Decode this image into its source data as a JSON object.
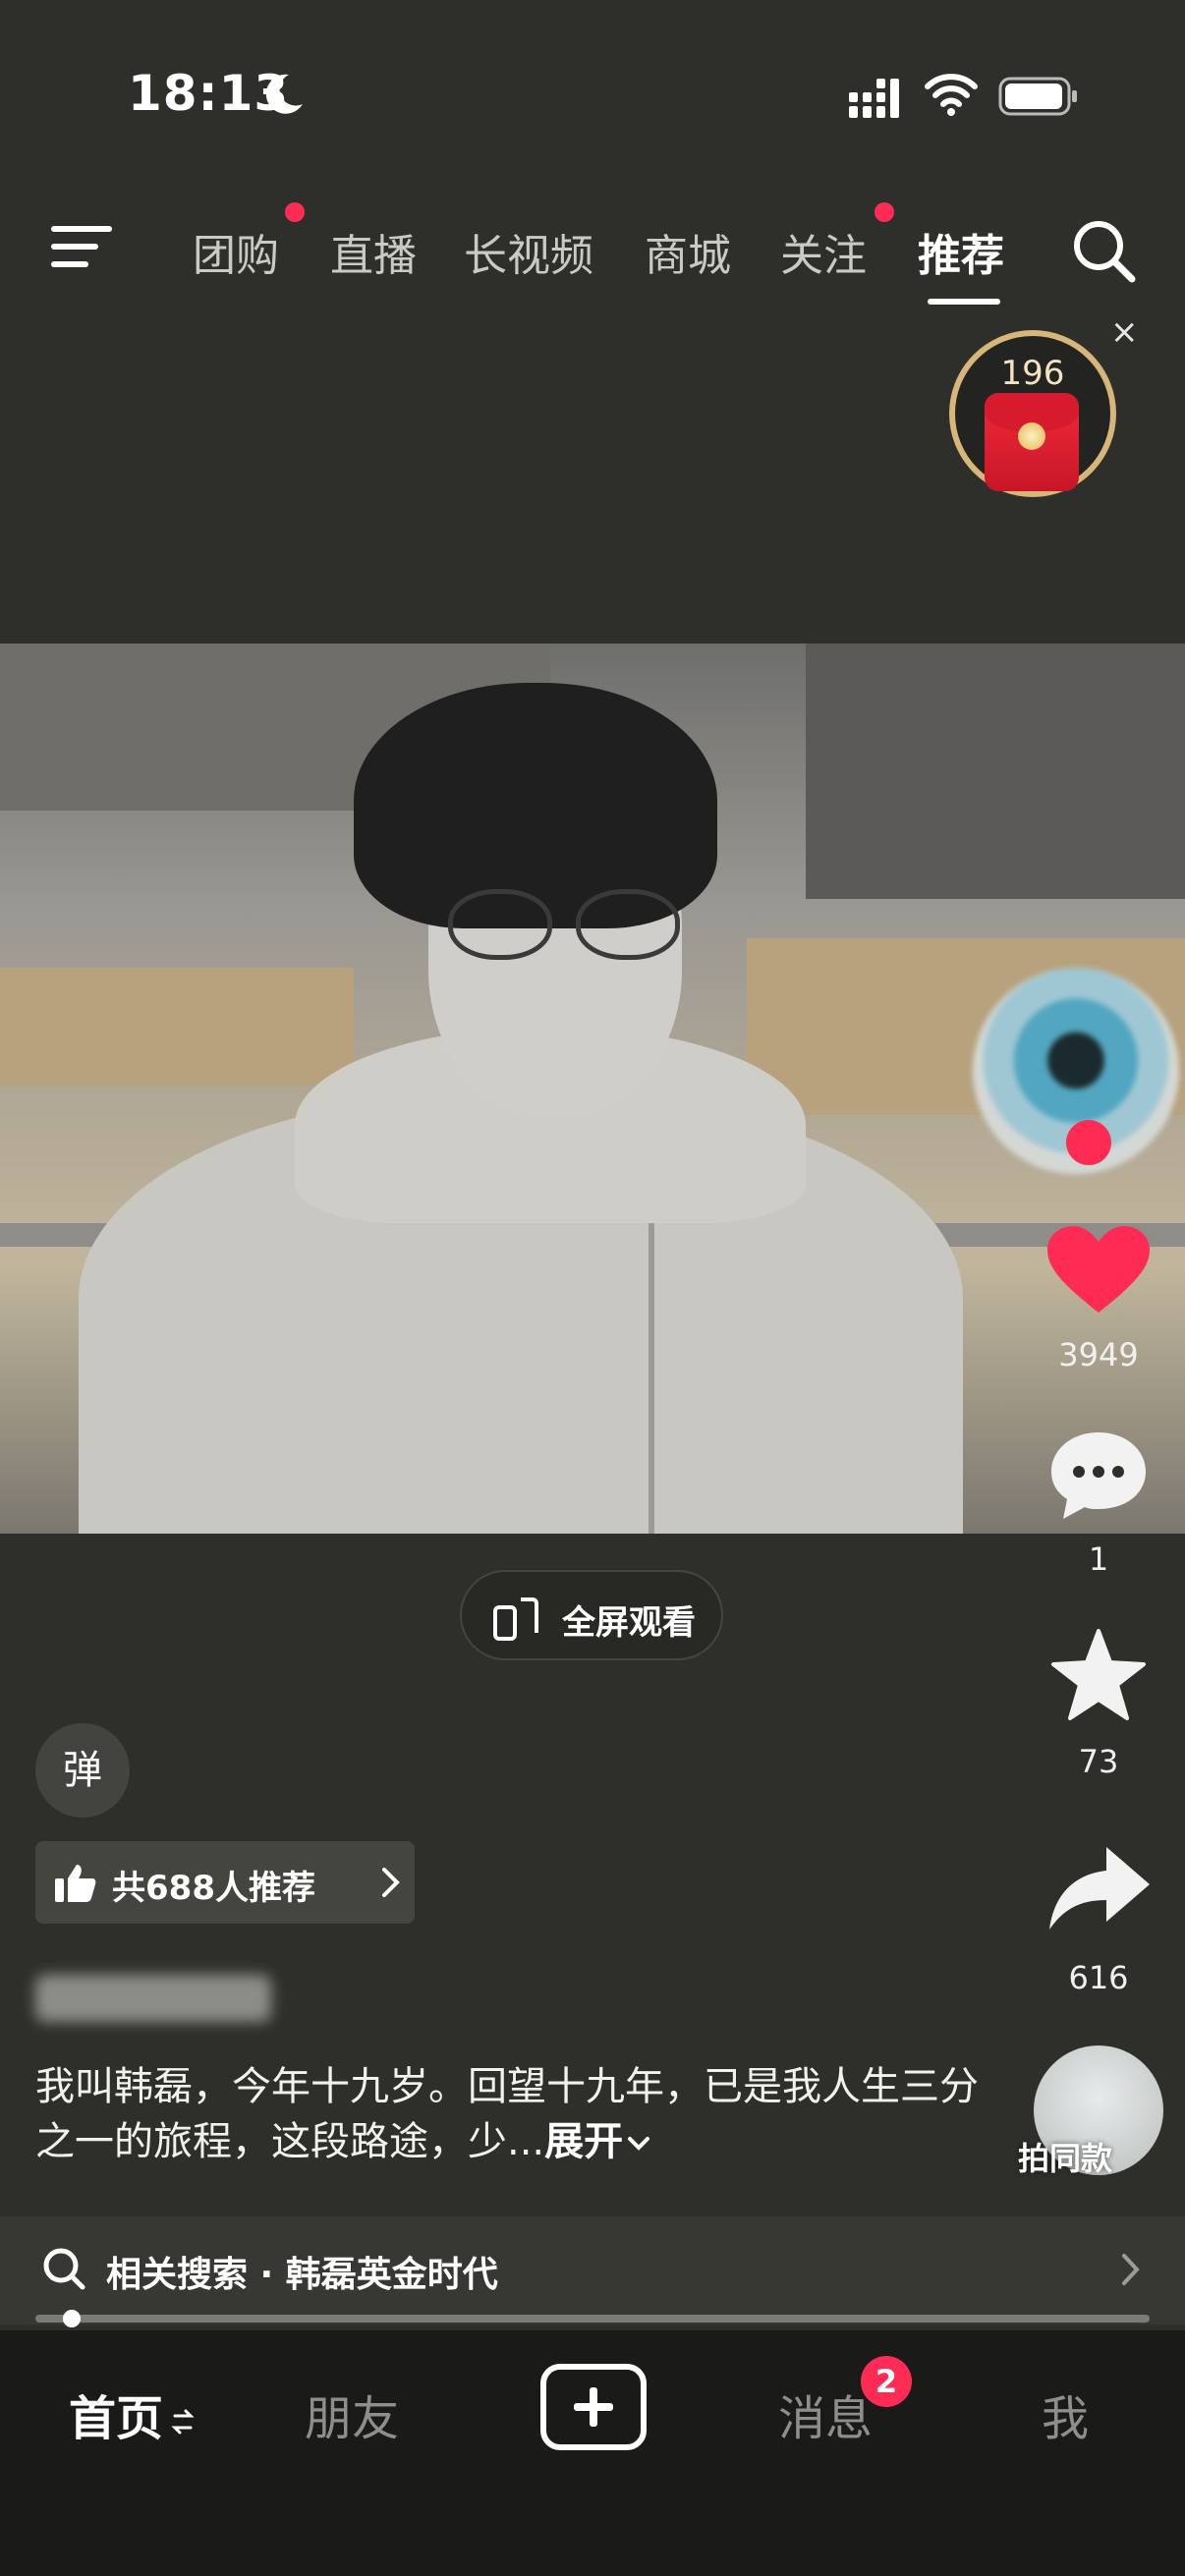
{
  "status_bar": {
    "time": "18:13"
  },
  "top_nav": {
    "tabs": [
      {
        "label": "团购"
      },
      {
        "label": "直播"
      },
      {
        "label": "长视频"
      },
      {
        "label": "商城"
      },
      {
        "label": "关注"
      },
      {
        "label": "推荐"
      }
    ],
    "active_tab": "推荐"
  },
  "red_packet": {
    "count": "196",
    "close": "×"
  },
  "video": {
    "fullscreen_label": "全屏观看"
  },
  "right_rail": {
    "like_count": "3949",
    "comment_count": "1",
    "favorite_count": "73",
    "share_count": "616",
    "shoot_same_label": "拍同款"
  },
  "danmaku_label": "弹",
  "recommend": {
    "label": "共688人推荐"
  },
  "caption": {
    "text": "我叫韩磊，今年十九岁。回望十九年，已是我人生三分之一的旅程，这段路途，少...",
    "expand_label": "展开"
  },
  "related_search": {
    "label": "相关搜索 · 韩磊英金时代"
  },
  "progress": {
    "fraction": 0.02
  },
  "bottom_nav": {
    "items": [
      {
        "label": "首页"
      },
      {
        "label": "朋友"
      },
      {
        "label": "消息"
      },
      {
        "label": "我"
      }
    ],
    "message_badge": "2"
  },
  "colors": {
    "accent": "#fe2c55",
    "background": "#2e2f2a",
    "nav_background": "#1a1a18"
  }
}
